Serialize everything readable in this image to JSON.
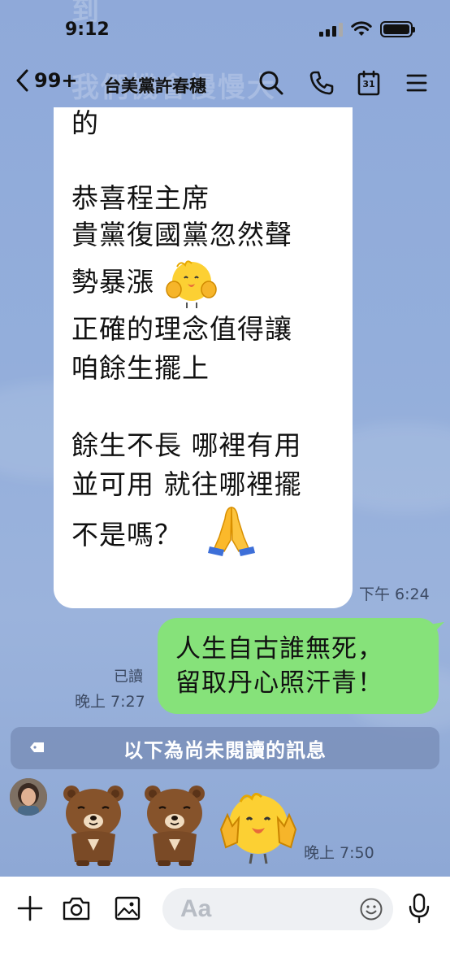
{
  "status": {
    "time": "9:12"
  },
  "header": {
    "back_count": "99+",
    "title": "台美黨許春穗",
    "calendar_day": "31"
  },
  "background_ghost": {
    "line1": "到",
    "line2": "我們機會慢慢大"
  },
  "incoming_message": {
    "lines": [
      "的",
      "",
      "恭喜程主席",
      "貴黨復國黨忽然聲",
      "勢暴漲",
      "正確的理念值得讓",
      "咱餘生擺上",
      "",
      "餘生不長 哪裡有用",
      "並可用 就往哪裡擺",
      "不是嗎？"
    ],
    "time": "下午 6:24"
  },
  "outgoing_message": {
    "lines": [
      "人生自古誰無死，",
      "留取丹心照汗青！"
    ],
    "read_label": "已讀",
    "time": "晚上 7:27"
  },
  "unread_divider": {
    "text": "以下為尚未閱讀的訊息"
  },
  "sticker_message": {
    "stickers": [
      "brown-bear-bow-sticker",
      "brown-bear-bow-sticker",
      "yellow-chick-sticker"
    ],
    "time": "晚上 7:50"
  },
  "input": {
    "placeholder": "Aa"
  },
  "colors": {
    "chat_bg": "#8fa9d6",
    "outgoing_bubble": "#86e27a",
    "incoming_bubble": "#ffffff",
    "unread_bar": "#7a8fba"
  }
}
